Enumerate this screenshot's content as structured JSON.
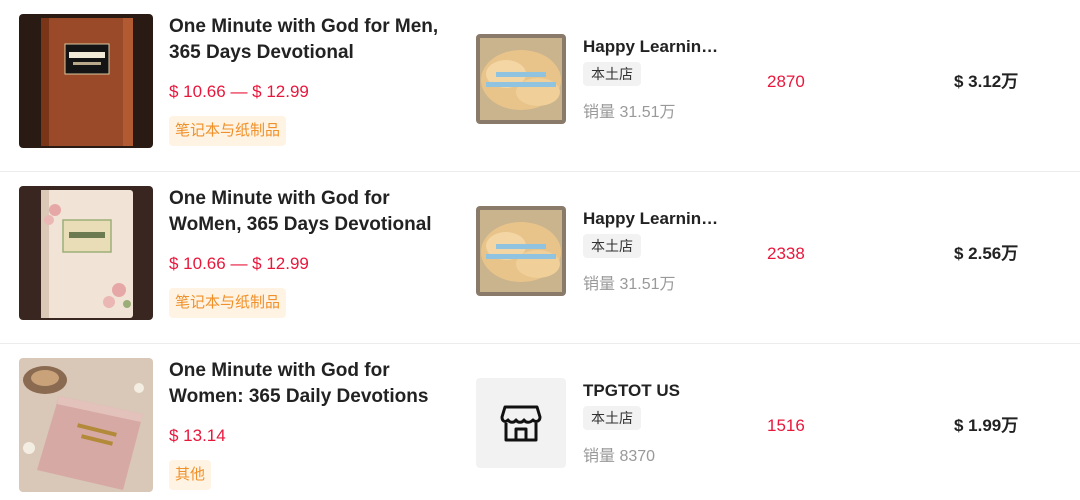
{
  "colors": {
    "price": "#e8173c",
    "category_bg": "#fff4e3",
    "category_text": "#f0902a",
    "sales_muted": "#999999"
  },
  "rows": [
    {
      "image_icon": "brown-devotional-book",
      "title": "One Minute with God for Men, 365 Days Devotional",
      "price": "$ 10.66 — $ 12.99",
      "category": "笔记本与纸制品",
      "shop_name": "Happy Learning Shop",
      "shop_avatar_icon": "happy-learning-shop-logo",
      "shop_tag": "本土店",
      "shop_sales": "销量 31.51万",
      "sold": "2870",
      "revenue": "$ 3.12万"
    },
    {
      "image_icon": "floral-devotional-book",
      "title": "One Minute with God for WoMen, 365 Days Devotional",
      "price": "$ 10.66 — $ 12.99",
      "category": "笔记本与纸制品",
      "shop_name": "Happy Learning Shop",
      "shop_avatar_icon": "happy-learning-shop-logo",
      "shop_tag": "本土店",
      "shop_sales": "销量 31.51万",
      "sold": "2338",
      "revenue": "$ 2.56万"
    },
    {
      "image_icon": "pink-devotional-book",
      "title": "One Minute with God for Women: 365 Daily Devotions",
      "price": "$ 13.14",
      "category": "其他",
      "shop_name": "TPGTOT US",
      "shop_avatar_icon": "storefront-icon",
      "shop_tag": "本土店",
      "shop_sales": "销量 8370",
      "sold": "1516",
      "revenue": "$ 1.99万"
    }
  ]
}
